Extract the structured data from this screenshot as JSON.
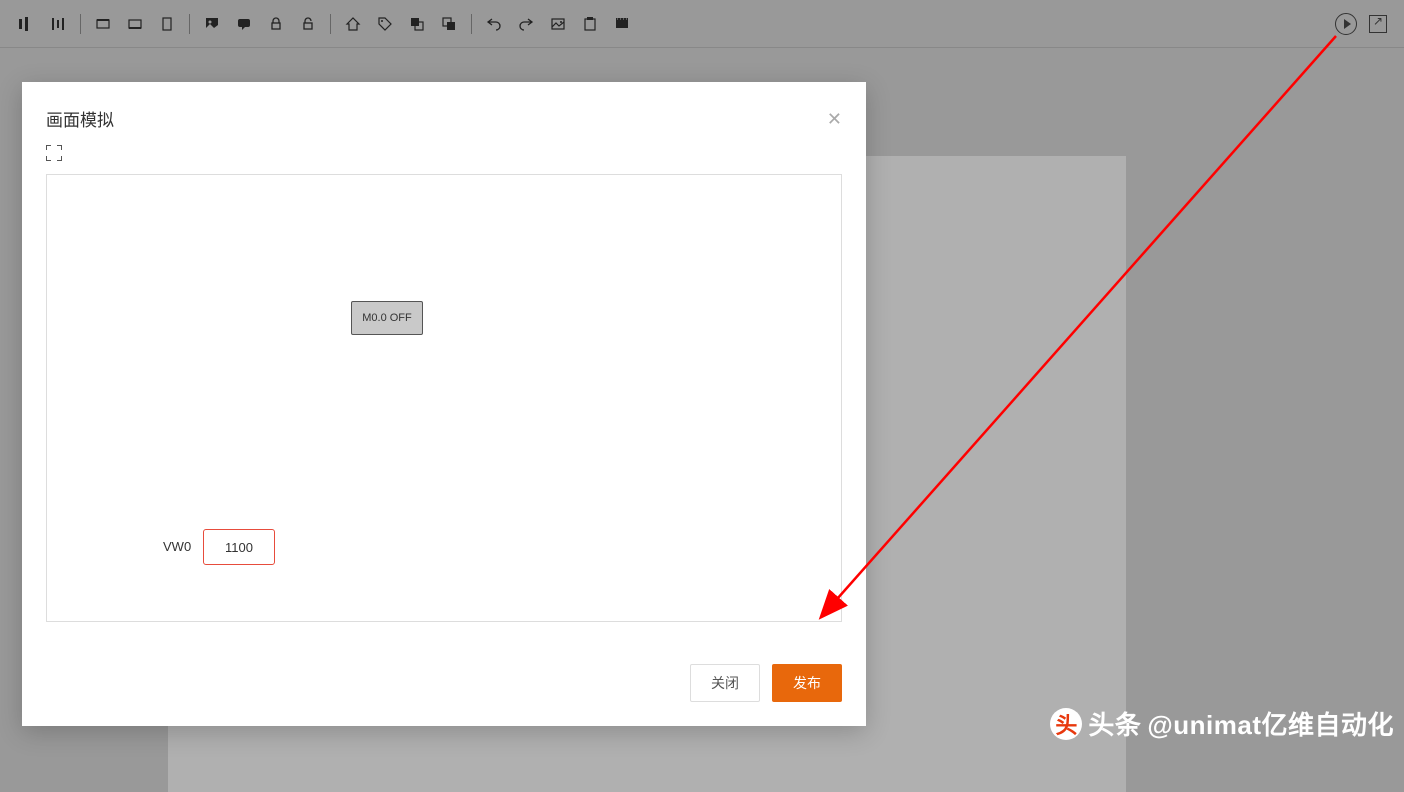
{
  "toolbar": {
    "icons_left": [
      "align-icon",
      "distribute-icon",
      "rect-t-icon",
      "rect-b-icon",
      "device-icon",
      "image-icon",
      "chat-icon",
      "lock-icon",
      "unlock-icon",
      "home-icon",
      "tag-icon",
      "layers-front-icon",
      "layers-back-icon",
      "undo-icon",
      "redo-icon",
      "picture-icon",
      "clipboard-icon",
      "film-icon"
    ],
    "icons_right": [
      "play-icon",
      "open-external-icon"
    ]
  },
  "modal": {
    "title": "画面模拟",
    "close_btn": "关闭",
    "publish_btn": "发布"
  },
  "hmi": {
    "state_button": "M0.0 OFF",
    "var_label": "VW0",
    "var_value": "1100"
  },
  "watermark": {
    "badge": "头",
    "prefix": "头条",
    "handle": "@unimat亿维自动化"
  }
}
